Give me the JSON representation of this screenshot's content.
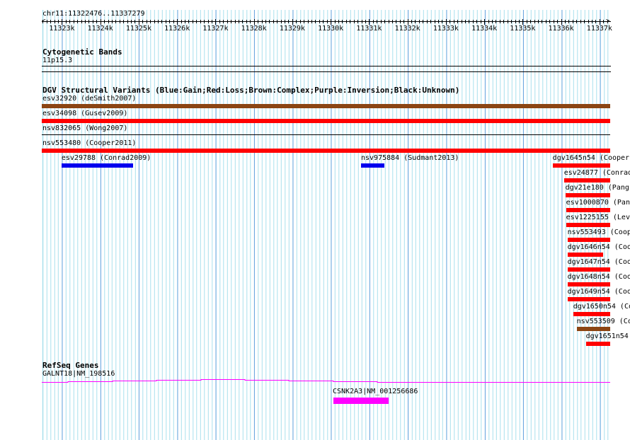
{
  "ruler": {
    "range_label": "chr11:11322476..11337279",
    "start": 11322476,
    "end": 11337279,
    "tick_labels": [
      "11323k",
      "11324k",
      "11325k",
      "11326k",
      "11327k",
      "11328k",
      "11329k",
      "11330k",
      "11331k",
      "11332k",
      "11333k",
      "11334k",
      "11335k",
      "11336k",
      "11337k"
    ]
  },
  "cytoband": {
    "title": "Cytogenetic Bands",
    "band": "11p15.3"
  },
  "dgv": {
    "title": "DGV Structural Variants (Blue:Gain;Red:Loss;Brown:Complex;Purple:Inversion;Black:Unknown)",
    "colors": {
      "gain": "#0000ee",
      "loss": "#ff0000",
      "complex": "#8b4513",
      "unknown": "#000000"
    },
    "features": [
      {
        "label": "esv32920 (deSmith2007)",
        "start": 11322476,
        "end": 11337279,
        "type": "complex",
        "row": 0
      },
      {
        "label": "esv34098 (Gusev2009)",
        "start": 11322476,
        "end": 11337279,
        "type": "loss",
        "row": 1
      },
      {
        "label": "nsv832065 (Wong2007)",
        "start": 11322476,
        "end": 11337279,
        "type": "unknown",
        "row": 2
      },
      {
        "label": "nsv553480 (Cooper2011)",
        "start": 11322476,
        "end": 11337279,
        "type": "loss",
        "row": 3
      },
      {
        "label": "esv29788 (Conrad2009)",
        "start": 11322990,
        "end": 11324850,
        "type": "gain",
        "row": 4
      },
      {
        "label": "nsv975884 (Sudmant2013)",
        "start": 11330790,
        "end": 11331400,
        "type": "gain",
        "row": 4
      },
      {
        "label": "dgv1645n54 (Cooper",
        "start": 11335780,
        "end": 11337279,
        "type": "loss",
        "row": 4
      },
      {
        "label": "esv24877 (Conrad",
        "start": 11336075,
        "end": 11337279,
        "type": "loss",
        "row": 5
      },
      {
        "label": "dgv21e180 (Pang",
        "start": 11336110,
        "end": 11337279,
        "type": "loss",
        "row": 6
      },
      {
        "label": "esv1000870 (Pan",
        "start": 11336130,
        "end": 11337279,
        "type": "loss",
        "row": 7
      },
      {
        "label": "esv1225155 (Lev",
        "start": 11336130,
        "end": 11337279,
        "type": "loss",
        "row": 8
      },
      {
        "label": "nsv553493 (Coop",
        "start": 11336165,
        "end": 11337279,
        "type": "loss",
        "row": 9
      },
      {
        "label": "dgv1646n54 (Coo",
        "start": 11336165,
        "end": 11337090,
        "type": "loss",
        "row": 10
      },
      {
        "label": "dgv1647n54 (Coo",
        "start": 11336165,
        "end": 11337279,
        "type": "loss",
        "row": 11
      },
      {
        "label": "dgv1648n54 (Coo",
        "start": 11336165,
        "end": 11337279,
        "type": "loss",
        "row": 12
      },
      {
        "label": "dgv1649n54 (Coo",
        "start": 11336165,
        "end": 11337279,
        "type": "loss",
        "row": 13
      },
      {
        "label": "dgv1650n54 (Co",
        "start": 11336315,
        "end": 11337279,
        "type": "loss",
        "row": 14
      },
      {
        "label": "nsv553509 (Co",
        "start": 11336405,
        "end": 11337279,
        "type": "complex",
        "row": 15
      },
      {
        "label": "dgv1651n54",
        "start": 11336645,
        "end": 11337279,
        "type": "loss",
        "row": 16
      }
    ]
  },
  "refseq": {
    "title": "RefSeq Genes",
    "color": "#ff00ff",
    "genes": [
      {
        "label": "GALNT18|NM_198516",
        "start": 11322476,
        "end": 11337279
      },
      {
        "label": "CSNK2A3|NM_001256686",
        "start": 11330065,
        "end": 11331505
      }
    ]
  }
}
